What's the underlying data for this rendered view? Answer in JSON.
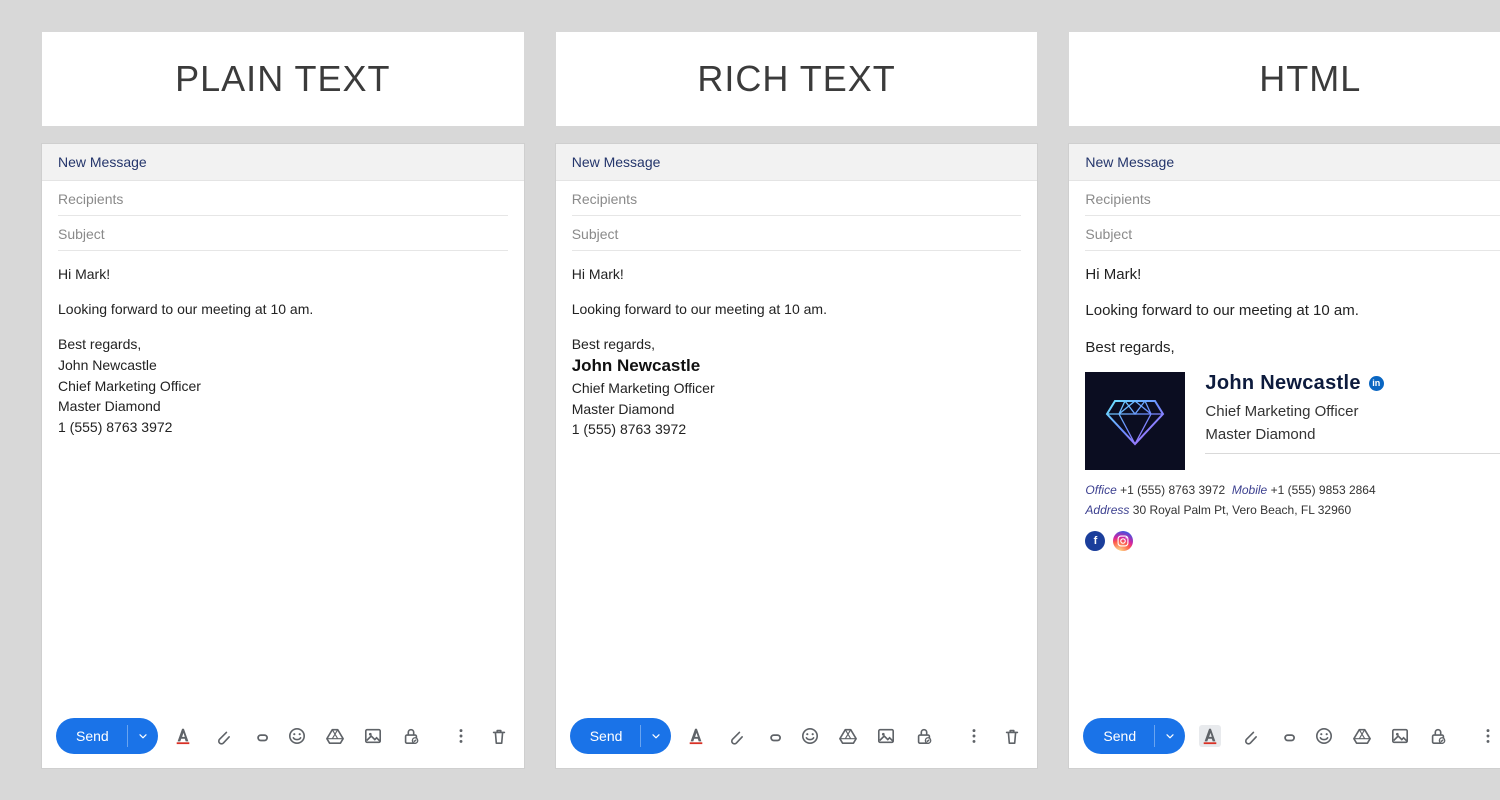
{
  "columns": [
    {
      "heading": "PLAIN TEXT"
    },
    {
      "heading": "RICH TEXT"
    },
    {
      "heading": "HTML"
    }
  ],
  "compose": {
    "header": "New Message",
    "recipients_placeholder": "Recipients",
    "subject_placeholder": "Subject",
    "send_label": "Send"
  },
  "body": {
    "greeting": "Hi Mark!",
    "line1": "Looking forward to our meeting at 10 am.",
    "closing": "Best regards,"
  },
  "plain_sig": {
    "name": "John Newcastle",
    "title": "Chief Marketing Officer",
    "company": "Master Diamond",
    "phone": "1 (555) 8763 3972"
  },
  "rich_sig": {
    "name": "John Newcastle",
    "title": "Chief Marketing Officer",
    "company": "Master Diamond",
    "phone": "1 (555) 8763 3972"
  },
  "html_sig": {
    "name": "John Newcastle",
    "title": "Chief Marketing Officer",
    "company": "Master Diamond",
    "office_label": "Office",
    "office_phone": "+1 (555) 8763 3972",
    "mobile_label": "Mobile",
    "mobile_phone": "+1 (555) 9853 2864",
    "address_label": "Address",
    "address": "30 Royal Palm Pt, Vero Beach, FL 32960",
    "linkedin_glyph": "in",
    "fb_glyph": "f"
  }
}
